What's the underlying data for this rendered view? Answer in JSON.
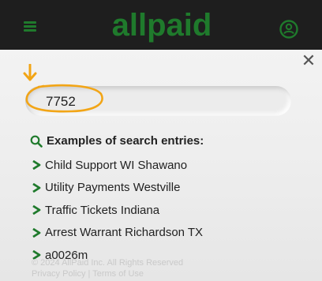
{
  "header": {
    "logo_text": "allpaid",
    "brand_color": "#1f7a2c",
    "background": "#1e1e1e",
    "menu_icon": "hamburger-menu-icon",
    "account_icon": "user-account-icon"
  },
  "search": {
    "close_label": "✕",
    "value": "7752",
    "arrow_color": "#f2a516",
    "circle_color": "#f2a516"
  },
  "examples": {
    "heading": "Examples of search entries:",
    "icon": "search-icon",
    "accent": "#1f7a2c",
    "items": [
      "Child Support WI Shawano",
      "Utility Payments Westville",
      "Traffic Tickets Indiana",
      "Arrest Warrant Richardson TX",
      "a0026m"
    ]
  },
  "footer": {
    "line1": "© 2024 AllPaid Inc. All Rights Reserved",
    "line2": "Privacy Policy | Terms of Use"
  }
}
